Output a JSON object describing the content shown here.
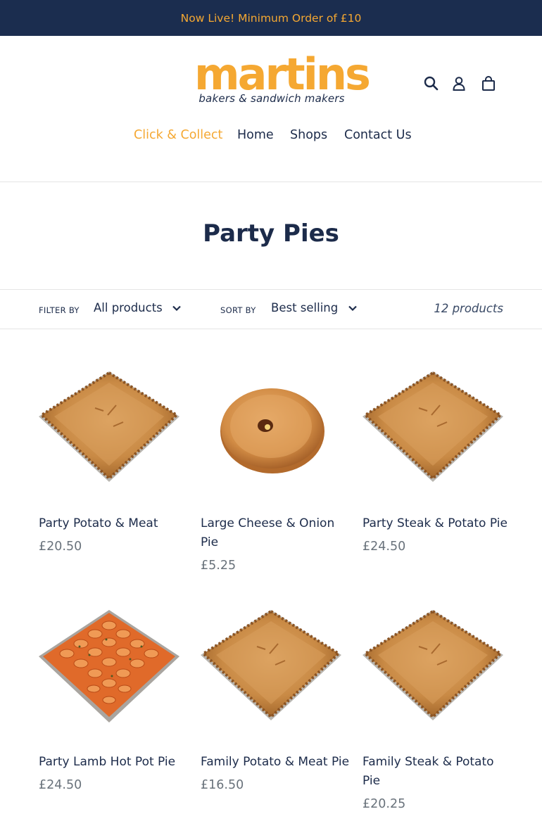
{
  "announcement": {
    "text": "Now Live! Minimum Order of £10"
  },
  "logo": {
    "main": "martins",
    "sub": "bakers & sandwich makers"
  },
  "header_icons": [
    "search-icon",
    "account-icon",
    "cart-icon"
  ],
  "nav": {
    "items": [
      "Click & Collect",
      "Home",
      "Shops",
      "Contact Us"
    ],
    "active": "Click & Collect"
  },
  "collection": {
    "title": "Party Pies"
  },
  "toolbar": {
    "filter_label": "FILTER BY",
    "filter_value": "All products",
    "sort_label": "SORT BY",
    "sort_value": "Best selling",
    "count": "12 products"
  },
  "products": [
    {
      "name": "Party Potato & Meat",
      "price": "£20.50",
      "image": "square-pie"
    },
    {
      "name": "Large Cheese & Onion Pie",
      "price": "£5.25",
      "image": "round-pie"
    },
    {
      "name": "Party Steak & Potato Pie",
      "price": "£24.50",
      "image": "square-pie"
    },
    {
      "name": "Party Lamb Hot Pot Pie",
      "price": "£24.50",
      "image": "hotpot-pie"
    },
    {
      "name": "Family Potato & Meat Pie",
      "price": "£16.50",
      "image": "square-pie"
    },
    {
      "name": "Family Steak & Potato Pie",
      "price": "£20.25",
      "image": "square-pie"
    }
  ],
  "colors": {
    "navy": "#1b2d4f",
    "accent": "#f5a832",
    "price_grey": "#69727b"
  }
}
